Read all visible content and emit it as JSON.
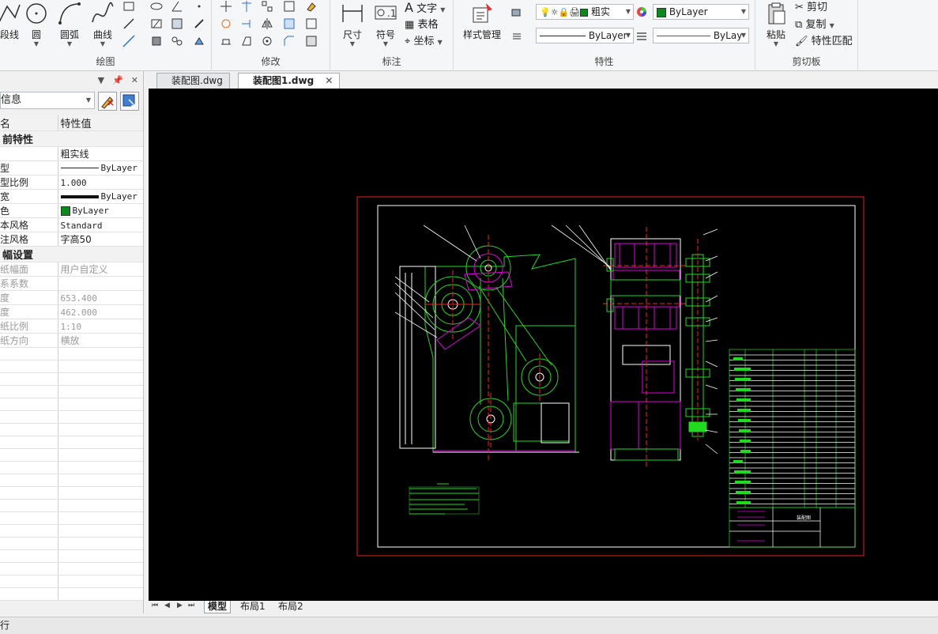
{
  "ribbon": {
    "draw": {
      "title": "绘图",
      "polyline": "段线",
      "circle": "圆",
      "arc": "圆弧",
      "curve": "曲线"
    },
    "modify": {
      "title": "修改"
    },
    "annotate": {
      "title": "标注",
      "dimension": "尺寸",
      "symbol": "符号",
      "text": "文字",
      "table": "表格",
      "coordinate": "坐标"
    },
    "properties": {
      "title": "特性",
      "style_manager": "样式管理",
      "layer_value": "粗实",
      "color_value": "ByLayer",
      "linetype_value": "ByLayer",
      "lineweight_value": "ByLay"
    },
    "clipboard": {
      "title": "剪切板",
      "paste": "粘贴",
      "cut": "剪切",
      "copy": "复制",
      "match_properties": "特性匹配"
    }
  },
  "panel": {
    "selector": "信息",
    "header_name": "名",
    "header_value": "特性值",
    "sections": [
      {
        "title": "前特性",
        "rows": [
          {
            "k": "",
            "v": "粗实线",
            "kind": "text"
          },
          {
            "k": "型",
            "v": "ByLayer",
            "kind": "thin"
          },
          {
            "k": "型比例",
            "v": "1.000",
            "kind": "mono"
          },
          {
            "k": "宽",
            "v": "ByLayer",
            "kind": "thick"
          },
          {
            "k": "色",
            "v": "ByLayer",
            "kind": "color"
          },
          {
            "k": "本风格",
            "v": "Standard",
            "kind": "mono"
          },
          {
            "k": "注风格",
            "v": "字高50",
            "kind": "text"
          }
        ]
      },
      {
        "title": "幅设置",
        "rows": [
          {
            "k": "纸幅面",
            "v": "用户自定义",
            "kind": "dis"
          },
          {
            "k": "系系数",
            "v": "",
            "kind": "dis"
          },
          {
            "k": "度",
            "v": "653.400",
            "kind": "dismono"
          },
          {
            "k": "度",
            "v": "462.000",
            "kind": "dismono"
          },
          {
            "k": "纸比例",
            "v": "1:10",
            "kind": "dismono"
          },
          {
            "k": "纸方向",
            "v": "横放",
            "kind": "dis"
          }
        ]
      }
    ]
  },
  "doc_tabs": [
    {
      "label": "装配图.dwg",
      "active": false
    },
    {
      "label": "装配图1.dwg",
      "active": true
    }
  ],
  "layout_tabs": [
    "模型",
    "布局1",
    "布局2"
  ],
  "title_block_label": "装配图",
  "status": {
    "text": "行"
  },
  "colors": {
    "canvas_bg": "#000000",
    "frame_outer": "#c0191a",
    "frame_inner": "#ffffff",
    "line_green": "#1fdc1f",
    "line_magenta": "#e000e0",
    "line_white": "#ffffff",
    "line_red": "#ff2020"
  }
}
